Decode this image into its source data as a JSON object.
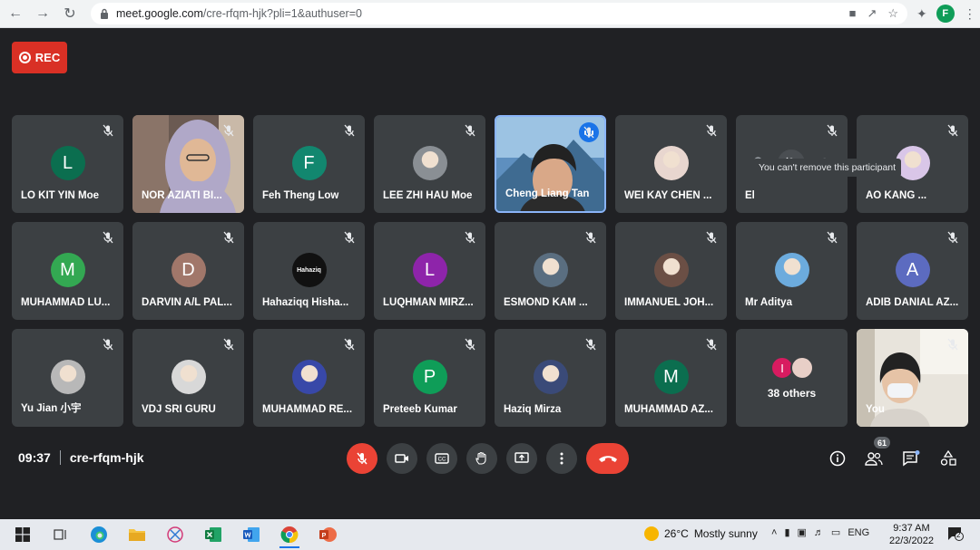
{
  "browser": {
    "url_host": "meet.google.com",
    "url_path": "/cre-rfqm-hjk?pli=1&authuser=0",
    "profile_initial": "F"
  },
  "meeting": {
    "rec_label": "REC",
    "time": "09:37",
    "code": "cre-rfqm-hjk",
    "tooltip": "You can't remove this participant",
    "people_count": "61"
  },
  "participants": [
    {
      "name": "LO KIT YIN Moe",
      "initial": "L",
      "color": "#0b6e4f",
      "kind": "letter"
    },
    {
      "name": "NOR AZIATI BI...",
      "kind": "video-a"
    },
    {
      "name": "Feh Theng Low",
      "initial": "F",
      "color": "#12876f",
      "kind": "letter"
    },
    {
      "name": "LEE ZHI HAU Moe",
      "kind": "photo",
      "color": "#8a8f94"
    },
    {
      "name": "Cheng Liang Tan",
      "kind": "video-b"
    },
    {
      "name": "WEI KAY CHEN ...",
      "kind": "photo",
      "color": "#e8d6cf"
    },
    {
      "name": "El",
      "kind": "hover"
    },
    {
      "name": "AO KANG ...",
      "kind": "photo",
      "color": "#d9c6e8"
    },
    {
      "name": "MUHAMMAD LU...",
      "initial": "M",
      "color": "#33a852",
      "kind": "letter"
    },
    {
      "name": "DARVIN A/L PAL...",
      "initial": "D",
      "color": "#a1776a",
      "kind": "letter"
    },
    {
      "name": "Hahaziqq Hisha...",
      "kind": "photo",
      "color": "#111111",
      "label": "Hahaziq"
    },
    {
      "name": "LUQHMAN MIRZ...",
      "initial": "L",
      "color": "#8e24aa",
      "kind": "letter"
    },
    {
      "name": "ESMOND KAM ...",
      "kind": "photo",
      "color": "#5a6e80"
    },
    {
      "name": "IMMANUEL JOH...",
      "kind": "photo",
      "color": "#6b4f45"
    },
    {
      "name": "Mr Aditya",
      "kind": "photo",
      "color": "#6cabdd"
    },
    {
      "name": "ADIB DANIAL AZ...",
      "initial": "A",
      "color": "#5c6bc0",
      "kind": "letter"
    },
    {
      "name": "Yu Jian 小宇",
      "kind": "photo",
      "color": "#b8b8b8"
    },
    {
      "name": "VDJ SRI GURU",
      "kind": "photo",
      "color": "#d8d8d8"
    },
    {
      "name": "MUHAMMAD RE...",
      "kind": "photo",
      "color": "#3848a8"
    },
    {
      "name": "Preteeb Kumar",
      "initial": "P",
      "color": "#0f9d58",
      "kind": "letter"
    },
    {
      "name": "Haziq Mirza",
      "kind": "photo",
      "color": "#3a4a78"
    },
    {
      "name": "MUHAMMAD AZ...",
      "initial": "M",
      "color": "#0b6e4f",
      "kind": "letter"
    },
    {
      "name": "38 others",
      "kind": "others",
      "initial": "I"
    },
    {
      "name": "You",
      "kind": "video-c"
    }
  ],
  "taskbar": {
    "temperature": "26°C",
    "weather": "Mostly sunny",
    "language": "ENG",
    "time": "9:37 AM",
    "date": "22/3/2022",
    "notifications": "2"
  },
  "colors": {
    "background": "#202124",
    "tile": "#3c4043",
    "danger": "#ea4335",
    "accent": "#8ab4f8"
  }
}
